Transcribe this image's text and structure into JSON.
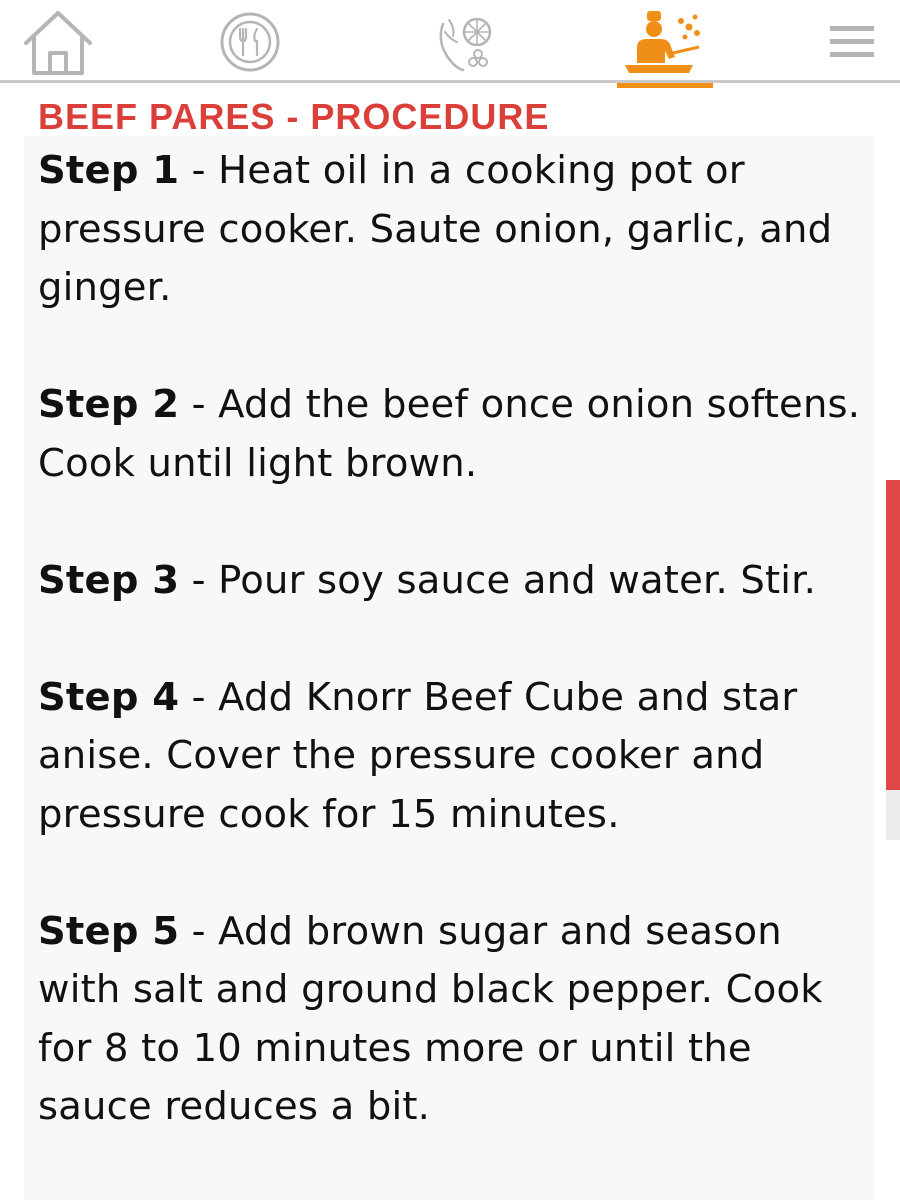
{
  "nav": {
    "items": [
      {
        "id": "home",
        "icon": "home-icon"
      },
      {
        "id": "menu",
        "icon": "plate-utensils-icon"
      },
      {
        "id": "ingredients",
        "icon": "vegetables-icon"
      },
      {
        "id": "procedure",
        "icon": "chef-cooking-icon",
        "active": true
      },
      {
        "id": "more",
        "icon": "hamburger-menu-icon"
      }
    ],
    "active_color": "#f08f17",
    "icon_color": "#b5b5b5"
  },
  "page": {
    "heading": "BEEF PARES - PROCEDURE",
    "heading_color": "#db3f39"
  },
  "steps": [
    {
      "label": "Step 1",
      "text": " - Heat oil in a cooking pot or pressure cooker. Saute onion, garlic, and ginger."
    },
    {
      "label": "Step 2",
      "text": " - Add the beef once onion softens. Cook until light brown."
    },
    {
      "label": "Step 3",
      "text": " - Pour soy sauce and water. Stir."
    },
    {
      "label": "Step 4",
      "text": " - Add Knorr Beef Cube and star anise. Cover the pressure cooker and pressure cook for 15 minutes."
    },
    {
      "label": "Step 5",
      "text": " - Add brown sugar and season with salt and ground black pepper. Cook for 8 to 10 minutes more or until the sauce reduces a bit."
    }
  ],
  "scrollbar": {
    "thumb_color": "#e04848"
  }
}
